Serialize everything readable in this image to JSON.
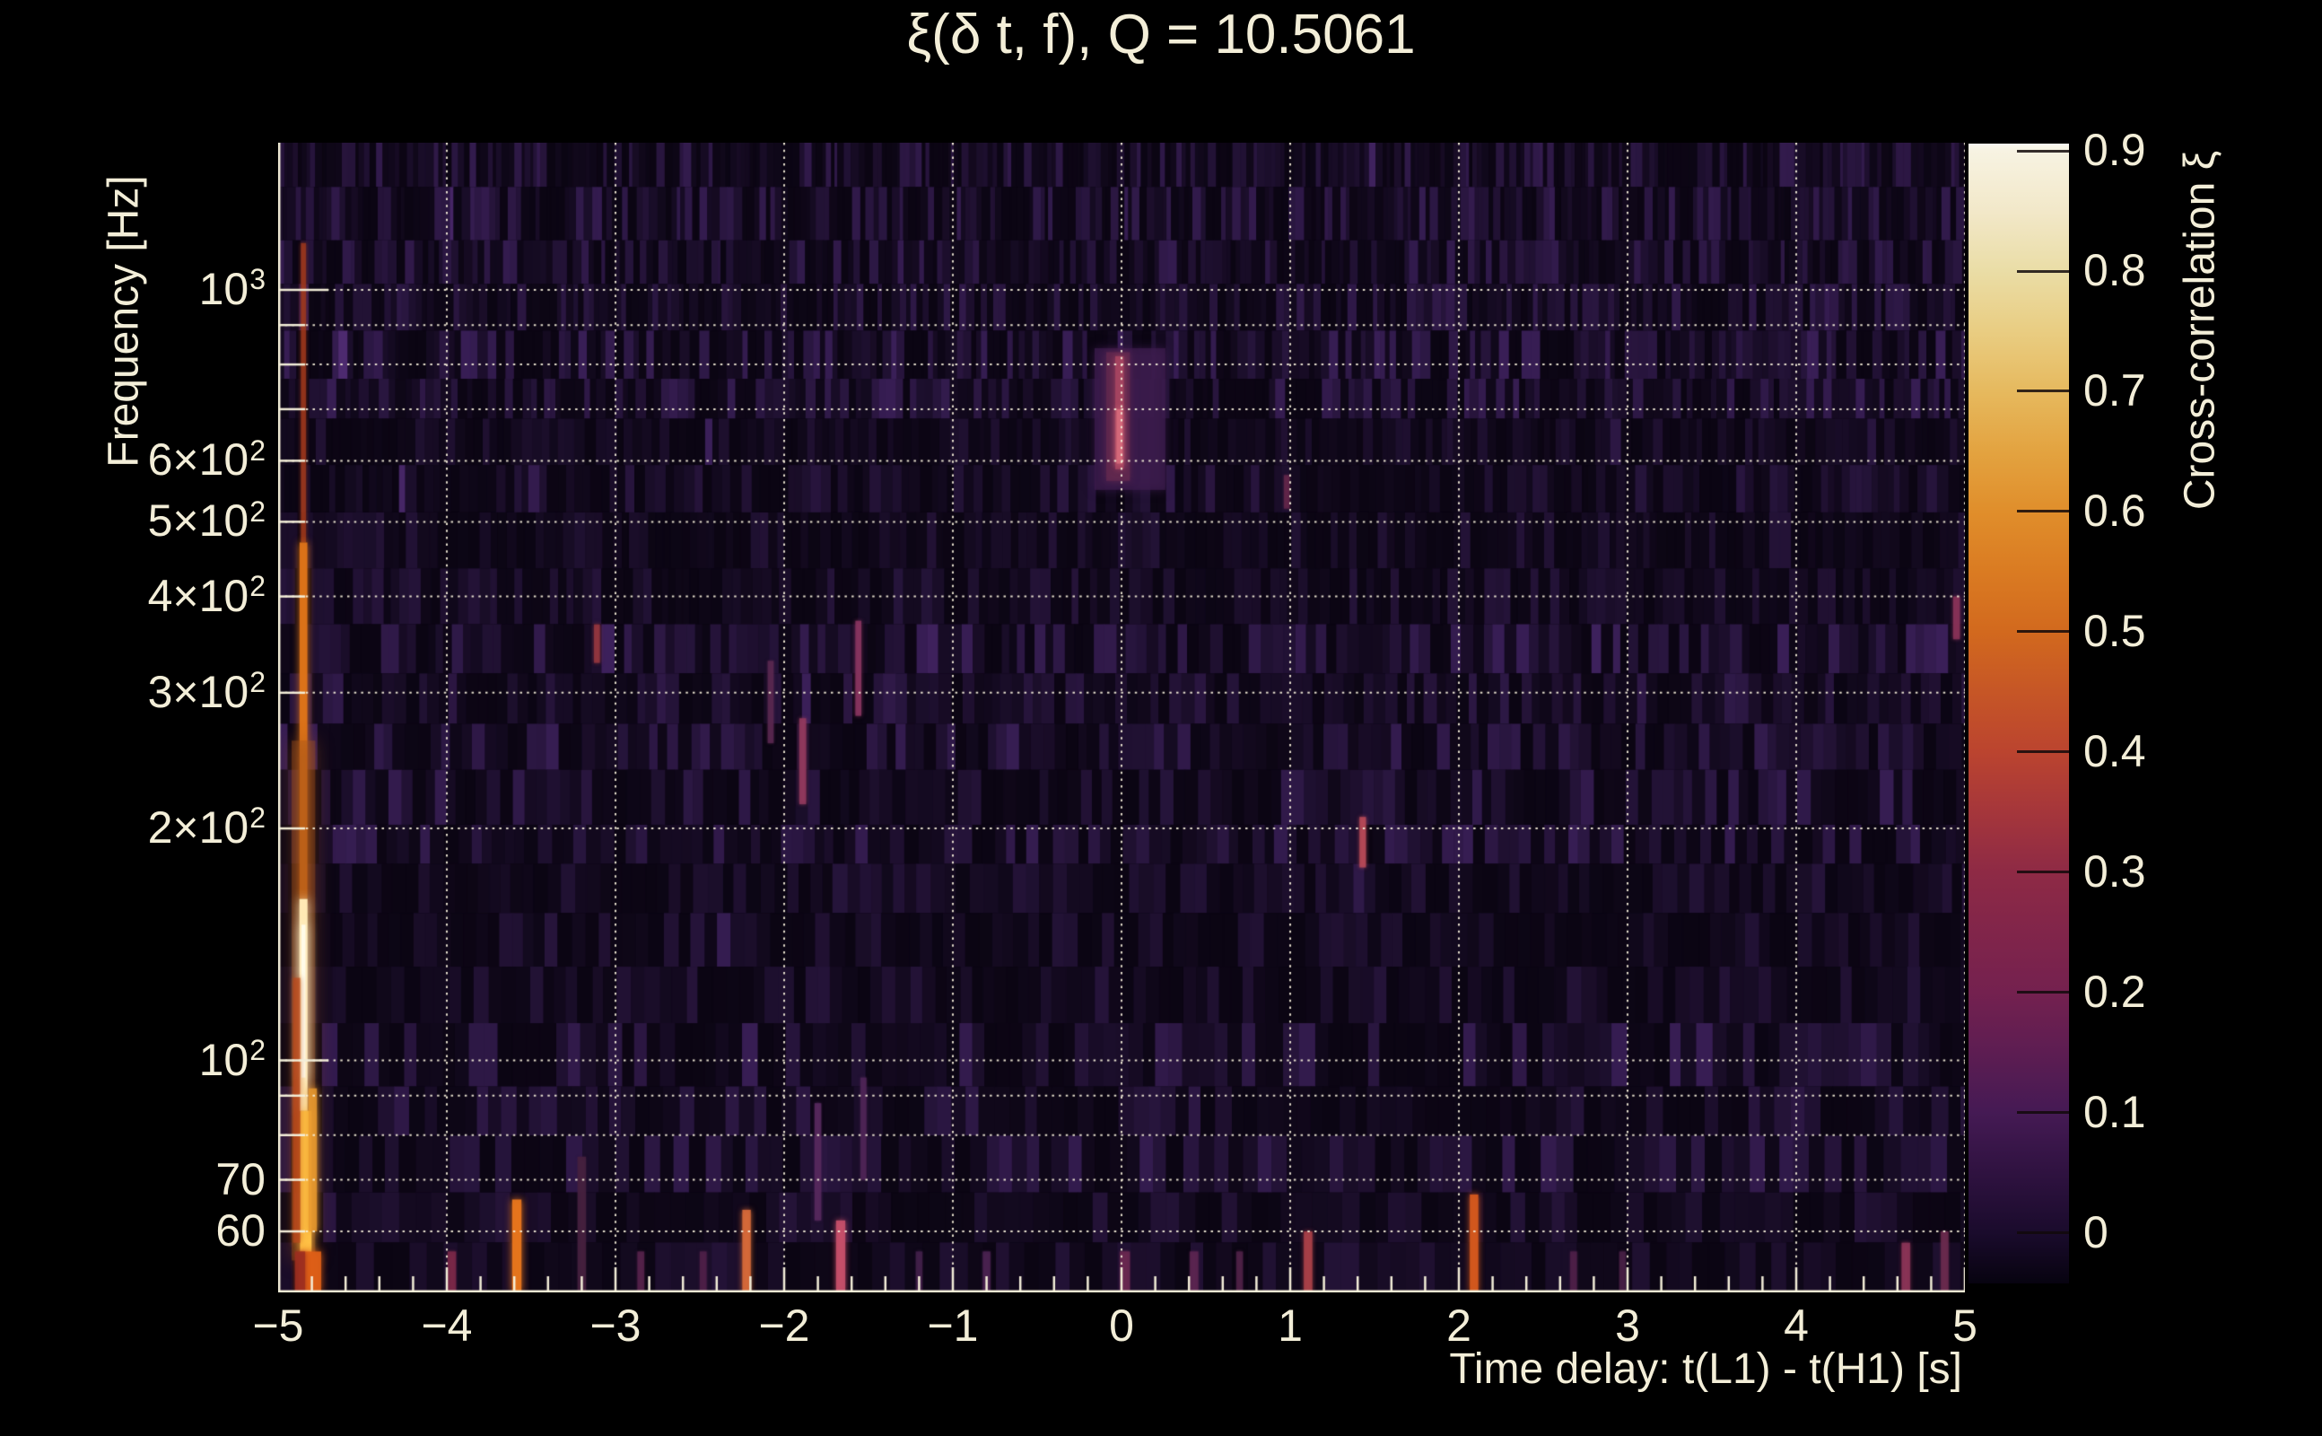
{
  "background_color": "#000000",
  "text_color": "#f3eed8",
  "chart_data": {
    "type": "heatmap",
    "title": "ξ(δ t, f), Q = 10.5061",
    "xlabel": "Time delay: t(L1) - t(H1) [s]",
    "ylabel": "Frequency [Hz]",
    "zlabel": "Cross-correlation ξ",
    "x_range": [
      -5,
      5
    ],
    "y_range_hz": [
      50,
      1552
    ],
    "y_scale": "log",
    "x_minor_tick_step": 0.2,
    "x_tick_labels": [
      {
        "label": "−5",
        "t": -5
      },
      {
        "label": "−4",
        "t": -4
      },
      {
        "label": "−3",
        "t": -3
      },
      {
        "label": "−2",
        "t": -2
      },
      {
        "label": "−1",
        "t": -1
      },
      {
        "label": "0",
        "t": 0
      },
      {
        "label": "1",
        "t": 1
      },
      {
        "label": "2",
        "t": 2
      },
      {
        "label": "3",
        "t": 3
      },
      {
        "label": "4",
        "t": 4
      },
      {
        "label": "5",
        "t": 5
      }
    ],
    "y_tick_labels": [
      {
        "base": "10",
        "sup": "3",
        "f": 1000
      },
      {
        "base": "6×10",
        "sup": "2",
        "f": 600
      },
      {
        "base": "5×10",
        "sup": "2",
        "f": 500
      },
      {
        "base": "4×10",
        "sup": "2",
        "f": 400
      },
      {
        "base": "3×10",
        "sup": "2",
        "f": 300
      },
      {
        "base": "2×10",
        "sup": "2",
        "f": 200
      },
      {
        "base": "10",
        "sup": "2",
        "f": 100
      },
      {
        "base": "70",
        "sup": "",
        "f": 70
      },
      {
        "base": "60",
        "sup": "",
        "f": 60
      }
    ],
    "grid_hz": [
      60,
      70,
      80,
      90,
      100,
      200,
      300,
      400,
      500,
      600,
      700,
      800,
      900,
      1000
    ],
    "grid_t": [
      -5,
      -4,
      -3,
      -2,
      -1,
      0,
      1,
      2,
      3,
      4,
      5
    ],
    "colorbar": {
      "tick_labels": [
        "0.9",
        "0.8",
        "0.7",
        "0.6",
        "0.5",
        "0.4",
        "0.3",
        "0.2",
        "0.1",
        "0"
      ],
      "tick_values": [
        0.9,
        0.8,
        0.7,
        0.6,
        0.5,
        0.4,
        0.3,
        0.2,
        0.1,
        0
      ],
      "top_value": 0.906,
      "bottom_value": -0.042,
      "stops": [
        {
          "v": 0.906,
          "color": "#fbf9f0"
        },
        {
          "v": 0.9,
          "color": "#f7f3e2"
        },
        {
          "v": 0.85,
          "color": "#f2e8c9"
        },
        {
          "v": 0.8,
          "color": "#eadda6"
        },
        {
          "v": 0.75,
          "color": "#e9cd82"
        },
        {
          "v": 0.7,
          "color": "#e6b95e"
        },
        {
          "v": 0.65,
          "color": "#e3a340"
        },
        {
          "v": 0.6,
          "color": "#e08e2b"
        },
        {
          "v": 0.55,
          "color": "#da7b22"
        },
        {
          "v": 0.5,
          "color": "#d2691e"
        },
        {
          "v": 0.45,
          "color": "#c65626"
        },
        {
          "v": 0.4,
          "color": "#bb442f"
        },
        {
          "v": 0.35,
          "color": "#a5363b"
        },
        {
          "v": 0.3,
          "color": "#8e2a45"
        },
        {
          "v": 0.25,
          "color": "#81254a"
        },
        {
          "v": 0.2,
          "color": "#74214f"
        },
        {
          "v": 0.15,
          "color": "#5d1d52"
        },
        {
          "v": 0.1,
          "color": "#451a54"
        },
        {
          "v": 0.05,
          "color": "#2f1240"
        },
        {
          "v": 0,
          "color": "#1a0b2c"
        },
        {
          "v": -0.042,
          "color": "#070310"
        }
      ]
    },
    "noise": {
      "seed": 11,
      "base_color": "#0b0513",
      "stripe_color": "#3a1f58",
      "bright_color": "#4f2b72"
    },
    "features": [
      {
        "t": -4.85,
        "w": 0.03,
        "f_hi": 1150,
        "f_lo": 470,
        "color": "#a23a1c",
        "alpha": 0.75,
        "glow": 4
      },
      {
        "t": -4.85,
        "w": 0.046,
        "f_hi": 470,
        "f_lo": 162,
        "color": "#de7418",
        "alpha": 0.95,
        "glow": 9
      },
      {
        "t": -4.85,
        "w": 0.14,
        "f_hi": 260,
        "f_lo": 55,
        "color": "#a85518",
        "alpha": 0.4,
        "glow": 20
      },
      {
        "t": -4.85,
        "w": 0.048,
        "f_hi": 162,
        "f_lo": 86,
        "color": "#ffe9b4",
        "alpha": 1,
        "glow": 12
      },
      {
        "t": -4.85,
        "w": 0.024,
        "f_hi": 150,
        "f_lo": 95,
        "color": "#fffbe8",
        "alpha": 1,
        "glow": 14
      },
      {
        "t": -4.836,
        "w": 0.068,
        "f_hi": 86,
        "f_lo": 56,
        "color": "#ffc145",
        "alpha": 1,
        "glow": 11
      },
      {
        "t": -4.89,
        "w": 0.042,
        "f_hi": 128,
        "f_lo": 58,
        "color": "#bc4618",
        "alpha": 0.65,
        "glow": 6
      },
      {
        "t": -4.795,
        "w": 0.05,
        "f_hi": 92,
        "f_lo": 60,
        "color": "#e89a2e",
        "alpha": 0.8,
        "glow": 8
      },
      {
        "t": -4.81,
        "w": 0.13,
        "f_hi": 56.5,
        "f_lo": 50,
        "color": "#dd5f17",
        "alpha": 0.95,
        "glow": 8
      },
      {
        "t": -4.87,
        "w": 0.06,
        "f_hi": 56.5,
        "f_lo": 50,
        "color": "#9c2e20",
        "alpha": 0.85,
        "glow": 5
      },
      {
        "t": 0.05,
        "w": 0.42,
        "f_hi": 840,
        "f_lo": 550,
        "color": "#3c1c4e",
        "alpha": 0.75,
        "glow": 10
      },
      {
        "t": -0.02,
        "w": 0.14,
        "f_hi": 830,
        "f_lo": 565,
        "color": "#63294f",
        "alpha": 0.8,
        "glow": 8
      },
      {
        "t": -0.012,
        "w": 0.05,
        "f_hi": 820,
        "f_lo": 585,
        "color": "#a64560",
        "alpha": 0.9,
        "glow": 6
      },
      {
        "t": -0.012,
        "w": 0.034,
        "f_hi": 700,
        "f_lo": 595,
        "color": "#d4687a",
        "alpha": 1,
        "glow": 7
      },
      {
        "t": -3.11,
        "w": 0.035,
        "f_hi": 368,
        "f_lo": 328,
        "color": "#9a3840",
        "alpha": 0.8,
        "glow": 4
      },
      {
        "t": -1.89,
        "w": 0.04,
        "f_hi": 278,
        "f_lo": 215,
        "color": "#93395e",
        "alpha": 0.85,
        "glow": 4
      },
      {
        "t": -1.56,
        "w": 0.035,
        "f_hi": 372,
        "f_lo": 280,
        "color": "#8a3560",
        "alpha": 0.85,
        "glow": 4
      },
      {
        "t": -2.08,
        "w": 0.035,
        "f_hi": 330,
        "f_lo": 258,
        "color": "#5a2850",
        "alpha": 0.8,
        "glow": 3
      },
      {
        "t": 1.43,
        "w": 0.038,
        "f_hi": 207,
        "f_lo": 178,
        "color": "#b84a58",
        "alpha": 0.85,
        "glow": 4
      },
      {
        "t": 4.95,
        "w": 0.04,
        "f_hi": 400,
        "f_lo": 352,
        "color": "#8a3358",
        "alpha": 0.85,
        "glow": 4
      },
      {
        "t": -1.8,
        "w": 0.04,
        "f_hi": 88,
        "f_lo": 62,
        "color": "#55285c",
        "alpha": 0.9,
        "glow": 3
      },
      {
        "t": -1.53,
        "w": 0.035,
        "f_hi": 95,
        "f_lo": 70,
        "color": "#4e2456",
        "alpha": 0.85,
        "glow": 3
      },
      {
        "t": 0.98,
        "w": 0.035,
        "f_hi": 575,
        "f_lo": 520,
        "color": "#6e2a4e",
        "alpha": 0.6,
        "glow": 3
      },
      {
        "t": -3.97,
        "w": 0.05,
        "f_hi": 56.5,
        "f_lo": 50,
        "color": "#7a2848",
        "alpha": 0.85,
        "glow": 3
      },
      {
        "t": -3.585,
        "w": 0.055,
        "f_hi": 66,
        "f_lo": 50,
        "color": "#e8761c",
        "alpha": 0.95,
        "glow": 8
      },
      {
        "t": -3.2,
        "w": 0.05,
        "f_hi": 75,
        "f_lo": 50,
        "color": "#45203e",
        "alpha": 0.9,
        "glow": 3
      },
      {
        "t": -2.85,
        "w": 0.04,
        "f_hi": 56.5,
        "f_lo": 50,
        "color": "#55224a",
        "alpha": 0.85,
        "glow": 3
      },
      {
        "t": -2.48,
        "w": 0.04,
        "f_hi": 56.5,
        "f_lo": 50,
        "color": "#4e2048",
        "alpha": 0.85,
        "glow": 3
      },
      {
        "t": -2.223,
        "w": 0.05,
        "f_hi": 64,
        "f_lo": 50,
        "color": "#d86a3a",
        "alpha": 0.9,
        "glow": 6
      },
      {
        "t": -1.665,
        "w": 0.055,
        "f_hi": 62,
        "f_lo": 50,
        "color": "#c8506a",
        "alpha": 0.9,
        "glow": 6
      },
      {
        "t": -1.2,
        "w": 0.04,
        "f_hi": 56.5,
        "f_lo": 50,
        "color": "#42204a",
        "alpha": 0.85,
        "glow": 3
      },
      {
        "t": -0.8,
        "w": 0.045,
        "f_hi": 56.5,
        "f_lo": 50,
        "color": "#4a2250",
        "alpha": 0.85,
        "glow": 3
      },
      {
        "t": 0.02,
        "w": 0.06,
        "f_hi": 56.5,
        "f_lo": 50,
        "color": "#6a2850",
        "alpha": 0.85,
        "glow": 3
      },
      {
        "t": 0.43,
        "w": 0.05,
        "f_hi": 56.5,
        "f_lo": 50,
        "color": "#5a2550",
        "alpha": 0.85,
        "glow": 3
      },
      {
        "t": 0.7,
        "w": 0.04,
        "f_hi": 56.5,
        "f_lo": 50,
        "color": "#502248",
        "alpha": 0.8,
        "glow": 3
      },
      {
        "t": 1.106,
        "w": 0.05,
        "f_hi": 60,
        "f_lo": 50,
        "color": "#a84048",
        "alpha": 0.9,
        "glow": 5
      },
      {
        "t": 2.09,
        "w": 0.05,
        "f_hi": 67,
        "f_lo": 50,
        "color": "#d4581e",
        "alpha": 0.95,
        "glow": 7
      },
      {
        "t": 2.68,
        "w": 0.04,
        "f_hi": 56.5,
        "f_lo": 50,
        "color": "#4e2048",
        "alpha": 0.85,
        "glow": 3
      },
      {
        "t": 2.97,
        "w": 0.04,
        "f_hi": 56.5,
        "f_lo": 50,
        "color": "#482046",
        "alpha": 0.8,
        "glow": 3
      },
      {
        "t": 4.65,
        "w": 0.05,
        "f_hi": 58,
        "f_lo": 50,
        "color": "#8a3456",
        "alpha": 0.9,
        "glow": 4
      },
      {
        "t": 4.88,
        "w": 0.045,
        "f_hi": 60,
        "f_lo": 50,
        "color": "#6a2a4e",
        "alpha": 0.85,
        "glow": 3
      }
    ]
  }
}
